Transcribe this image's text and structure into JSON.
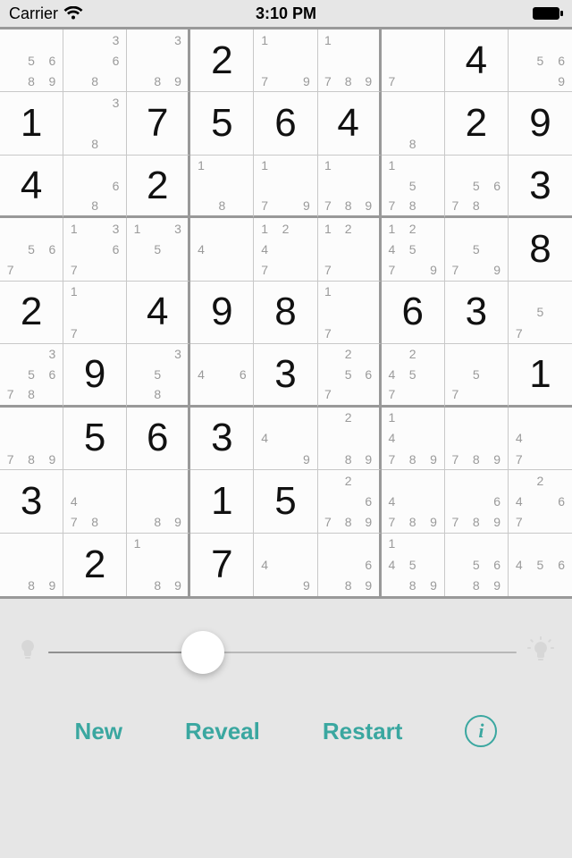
{
  "status_bar": {
    "carrier": "Carrier",
    "time": "3:10 PM"
  },
  "sudoku": {
    "grid": [
      [
        {
          "pencil": [
            5,
            6,
            8,
            9
          ]
        },
        {
          "pencil": [
            3,
            6,
            8
          ]
        },
        {
          "pencil": [
            3,
            8,
            9
          ]
        },
        {
          "value": 2
        },
        {
          "pencil": [
            1,
            7,
            9
          ]
        },
        {
          "pencil": [
            1,
            7,
            8,
            9
          ]
        },
        {
          "pencil": [
            7
          ]
        },
        {
          "value": 4
        },
        {
          "pencil": [
            5,
            6,
            9
          ]
        }
      ],
      [
        {
          "value": 1
        },
        {
          "pencil": [
            3,
            8
          ]
        },
        {
          "value": 7
        },
        {
          "value": 5
        },
        {
          "value": 6
        },
        {
          "value": 4
        },
        {
          "pencil": [
            8
          ]
        },
        {
          "value": 2
        },
        {
          "value": 9
        }
      ],
      [
        {
          "value": 4
        },
        {
          "pencil": [
            6,
            8
          ]
        },
        {
          "value": 2
        },
        {
          "pencil": [
            1,
            8
          ]
        },
        {
          "pencil": [
            1,
            7,
            9
          ]
        },
        {
          "pencil": [
            1,
            7,
            8,
            9
          ]
        },
        {
          "pencil": [
            1,
            5,
            7,
            8
          ]
        },
        {
          "pencil": [
            5,
            6,
            7,
            8
          ]
        },
        {
          "value": 3
        }
      ],
      [
        {
          "pencil": [
            5,
            6,
            7
          ]
        },
        {
          "pencil": [
            1,
            3,
            6,
            7
          ]
        },
        {
          "pencil": [
            1,
            3,
            5
          ]
        },
        {
          "pencil": [
            4
          ]
        },
        {
          "pencil": [
            1,
            2,
            4,
            7
          ]
        },
        {
          "pencil": [
            1,
            2,
            7
          ]
        },
        {
          "pencil": [
            1,
            2,
            4,
            5,
            7,
            9
          ]
        },
        {
          "pencil": [
            5,
            7,
            9
          ]
        },
        {
          "value": 8
        }
      ],
      [
        {
          "value": 2
        },
        {
          "pencil": [
            1,
            7
          ]
        },
        {
          "value": 4
        },
        {
          "value": 9
        },
        {
          "value": 8
        },
        {
          "pencil": [
            1,
            7
          ]
        },
        {
          "value": 6
        },
        {
          "value": 3
        },
        {
          "pencil": [
            5,
            7
          ]
        }
      ],
      [
        {
          "pencil": [
            3,
            5,
            6,
            7,
            8
          ]
        },
        {
          "value": 9
        },
        {
          "pencil": [
            3,
            5,
            8
          ]
        },
        {
          "pencil": [
            4,
            6
          ]
        },
        {
          "value": 3
        },
        {
          "pencil": [
            2,
            5,
            6,
            7
          ]
        },
        {
          "pencil": [
            2,
            4,
            5,
            7
          ]
        },
        {
          "pencil": [
            5,
            7
          ]
        },
        {
          "value": 1
        }
      ],
      [
        {
          "pencil": [
            7,
            8,
            9
          ]
        },
        {
          "value": 5
        },
        {
          "value": 6
        },
        {
          "value": 3
        },
        {
          "pencil": [
            4,
            9
          ]
        },
        {
          "pencil": [
            2,
            8,
            9
          ]
        },
        {
          "pencil": [
            1,
            4,
            7,
            8,
            9
          ]
        },
        {
          "pencil": [
            7,
            8,
            9
          ]
        },
        {
          "pencil": [
            4,
            7
          ]
        }
      ],
      [
        {
          "value": 3
        },
        {
          "pencil": [
            4,
            7,
            8
          ]
        },
        {
          "pencil": [
            8,
            9
          ]
        },
        {
          "value": 1
        },
        {
          "value": 5
        },
        {
          "pencil": [
            2,
            6,
            7,
            8,
            9
          ]
        },
        {
          "pencil": [
            4,
            7,
            8,
            9
          ]
        },
        {
          "pencil": [
            6,
            7,
            8,
            9
          ]
        },
        {
          "pencil": [
            2,
            4,
            6,
            7
          ]
        }
      ],
      [
        {
          "pencil": [
            8,
            9
          ]
        },
        {
          "value": 2
        },
        {
          "pencil": [
            1,
            8,
            9
          ]
        },
        {
          "value": 7
        },
        {
          "pencil": [
            4,
            9
          ]
        },
        {
          "pencil": [
            6,
            8,
            9
          ]
        },
        {
          "pencil": [
            1,
            4,
            5,
            8,
            9
          ]
        },
        {
          "pencil": [
            5,
            6,
            8,
            9
          ]
        },
        {
          "pencil": [
            4,
            5,
            6
          ]
        }
      ]
    ]
  },
  "slider": {
    "percent": 33
  },
  "buttons": {
    "new_label": "New",
    "reveal_label": "Reveal",
    "restart_label": "Restart"
  },
  "colors": {
    "accent": "#3aa7a0"
  }
}
